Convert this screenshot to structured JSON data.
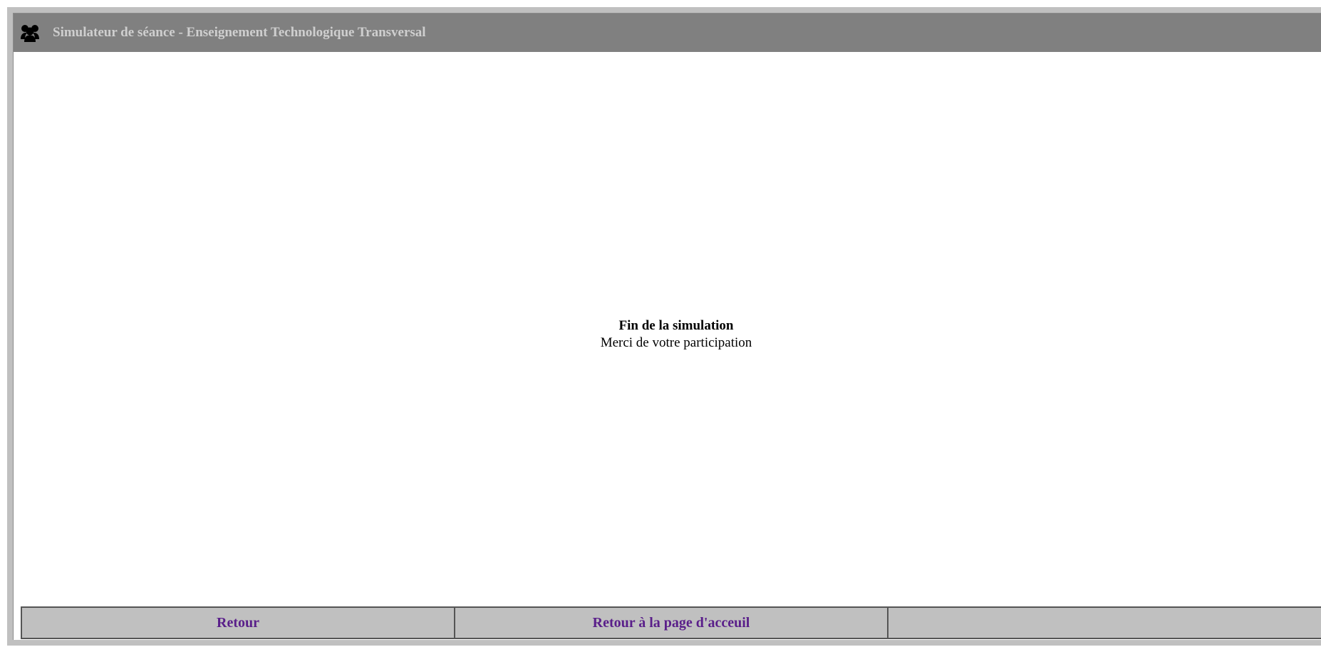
{
  "header": {
    "icon": "users-icon",
    "title": "Simulateur de séance - Enseignement Technologique Transversal"
  },
  "message": {
    "title": "Fin de la simulation",
    "subtitle": "Merci de votre participation"
  },
  "nav": {
    "back_label": "Retour",
    "home_label": "Retour à la page d'acceuil",
    "empty_label": ""
  },
  "colors": {
    "title_bar": "#808080",
    "title_text": "#cfcfcf",
    "frame": "#c0c0c0",
    "nav_bg": "#c0c0c0",
    "nav_link": "#5a1f8a"
  }
}
